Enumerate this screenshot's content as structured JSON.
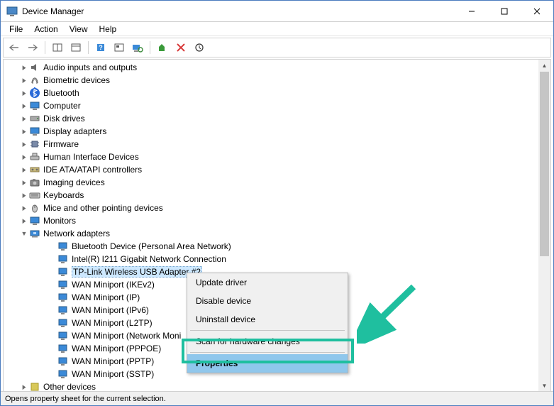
{
  "window": {
    "title": "Device Manager"
  },
  "menu": {
    "file": "File",
    "action": "Action",
    "view": "View",
    "help": "Help"
  },
  "tree": {
    "items": [
      {
        "label": "Audio inputs and outputs",
        "icon": "speaker"
      },
      {
        "label": "Biometric devices",
        "icon": "fingerprint"
      },
      {
        "label": "Bluetooth",
        "icon": "bluetooth"
      },
      {
        "label": "Computer",
        "icon": "monitor"
      },
      {
        "label": "Disk drives",
        "icon": "disk"
      },
      {
        "label": "Display adapters",
        "icon": "monitor"
      },
      {
        "label": "Firmware",
        "icon": "chip"
      },
      {
        "label": "Human Interface Devices",
        "icon": "hid"
      },
      {
        "label": "IDE ATA/ATAPI controllers",
        "icon": "ide"
      },
      {
        "label": "Imaging devices",
        "icon": "camera"
      },
      {
        "label": "Keyboards",
        "icon": "keyboard"
      },
      {
        "label": "Mice and other pointing devices",
        "icon": "mouse"
      },
      {
        "label": "Monitors",
        "icon": "monitor"
      }
    ],
    "network": {
      "label": "Network adapters",
      "children": [
        "Bluetooth Device (Personal Area Network)",
        "Intel(R) I211 Gigabit Network Connection",
        "TP-Link Wireless USB Adapter #2",
        "WAN Miniport (IKEv2)",
        "WAN Miniport (IP)",
        "WAN Miniport (IPv6)",
        "WAN Miniport (L2TP)",
        "WAN Miniport (Network Moni",
        "WAN Miniport (PPPOE)",
        "WAN Miniport (PPTP)",
        "WAN Miniport (SSTP)"
      ],
      "selected_index": 2
    },
    "last": {
      "label": "Other devices"
    }
  },
  "context_menu": {
    "items": [
      "Update driver",
      "Disable device",
      "Uninstall device"
    ],
    "scan": "Scan for hardware changes",
    "properties": "Properties"
  },
  "status": {
    "text": "Opens property sheet for the current selection."
  }
}
